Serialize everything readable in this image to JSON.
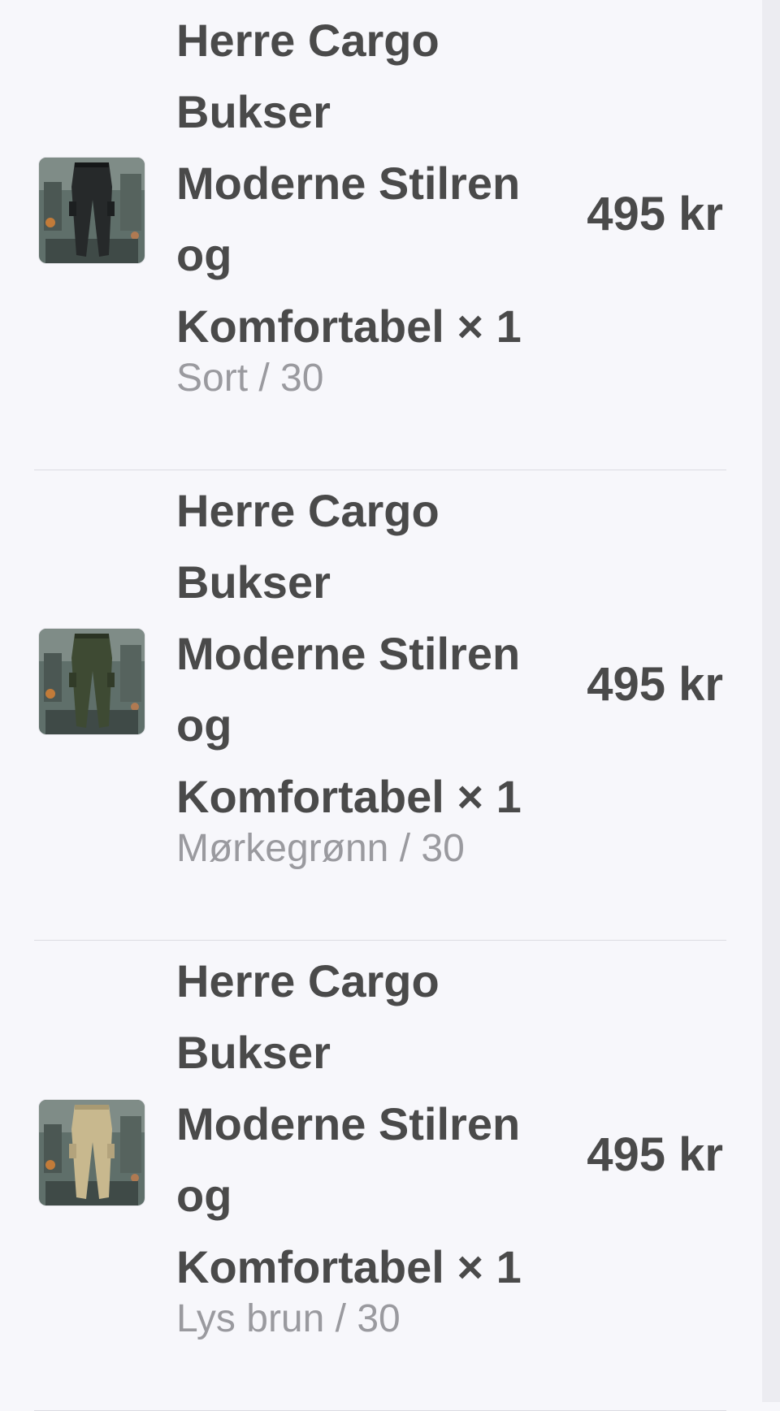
{
  "order_items": [
    {
      "title_line_1": "Herre Cargo",
      "title_line_2": "Bukser",
      "title_line_3": "Moderne Stilren",
      "title_line_4": "og",
      "title_line_5": "Komfortabel",
      "quantity": "× 1",
      "variant": "Sort / 30",
      "price": "495 kr",
      "image_icon": "black-cargo-pants-image",
      "pants_color": "#26292a"
    },
    {
      "title_line_1": "Herre Cargo",
      "title_line_2": "Bukser",
      "title_line_3": "Moderne Stilren",
      "title_line_4": "og",
      "title_line_5": "Komfortabel",
      "quantity": "× 1",
      "variant": "Mørkegrønn / 30",
      "price": "495 kr",
      "image_icon": "dark-green-cargo-pants-image",
      "pants_color": "#3e4a33"
    },
    {
      "title_line_1": "Herre Cargo",
      "title_line_2": "Bukser",
      "title_line_3": "Moderne Stilren",
      "title_line_4": "og",
      "title_line_5": "Komfortabel",
      "quantity": "× 1",
      "variant": "Lys brun / 30",
      "price": "495 kr",
      "image_icon": "light-brown-cargo-pants-image",
      "pants_color": "#c8b88e"
    }
  ]
}
